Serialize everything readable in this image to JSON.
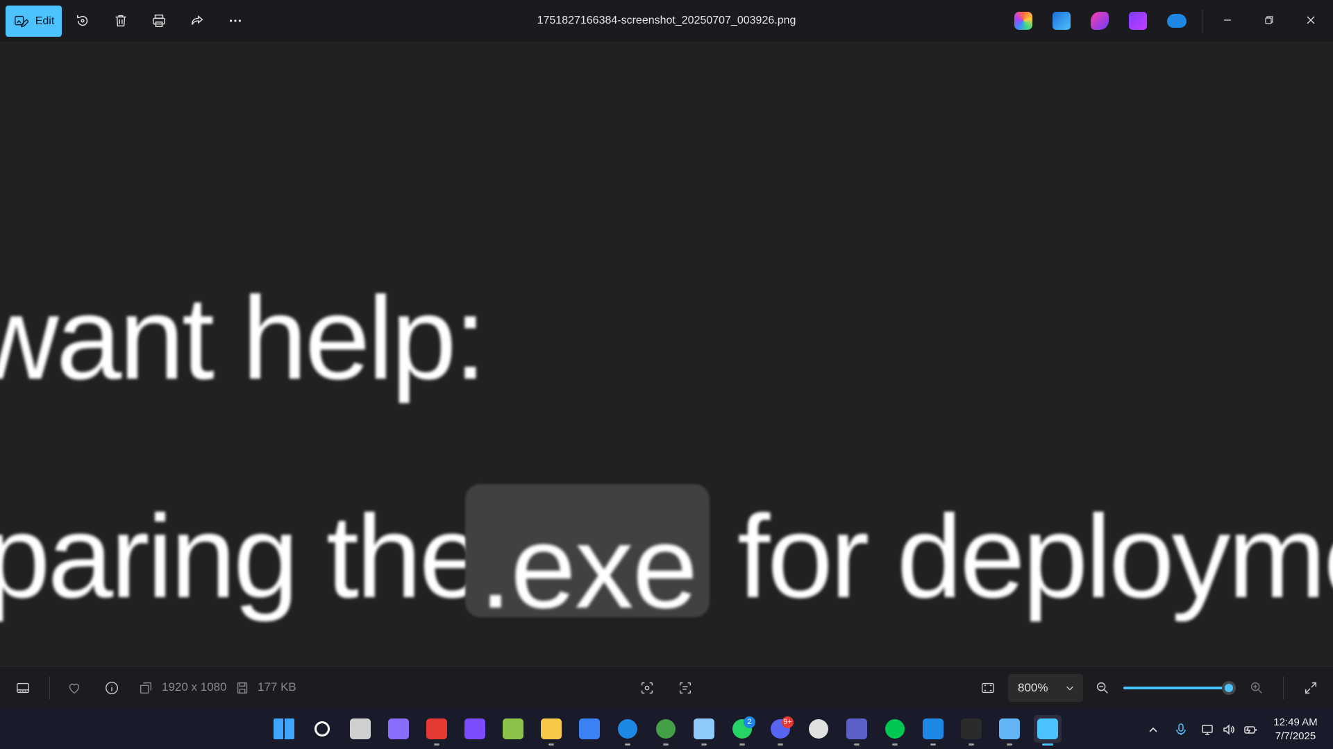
{
  "toolbar": {
    "edit_label": "Edit",
    "file_title": "1751827166384-screenshot_20250707_003926.png",
    "accent": "#4cc2ff"
  },
  "toolbar_icons": [
    "rotate-icon",
    "delete-icon",
    "print-icon",
    "share-icon",
    "more-icon"
  ],
  "toolbar_apps": [
    "copilot-icon",
    "photos-icon",
    "clipchamp-icon",
    "designer-icon",
    "onedrive-icon"
  ],
  "canvas": {
    "line1": "want help:",
    "line2_before": "paring the",
    "code": ".exe",
    "line2_after": "for deploymer"
  },
  "info_bar": {
    "dimensions": "1920 x 1080",
    "file_size": "177 KB",
    "zoom_value": "800%",
    "zoom_slider_fraction": 0.93
  },
  "taskbar": {
    "apps": [
      {
        "name": "start",
        "color": "#3ea6ff"
      },
      {
        "name": "search",
        "color": "#ffffff"
      },
      {
        "name": "task-view",
        "color": "#cfcfcf"
      },
      {
        "name": "copilot",
        "color": "#8a6cff"
      },
      {
        "name": "snipping-tool",
        "color": "#e53935"
      },
      {
        "name": "visual-studio",
        "color": "#7c4dff"
      },
      {
        "name": "app-chameleon",
        "color": "#8bc34a"
      },
      {
        "name": "file-explorer",
        "color": "#f7c948"
      },
      {
        "name": "microsoft-store",
        "color": "#3b82f6"
      },
      {
        "name": "edge",
        "color": "#1e88e5"
      },
      {
        "name": "chrome",
        "color": "#43a047"
      },
      {
        "name": "remote-desktop",
        "color": "#90caf9"
      },
      {
        "name": "whatsapp",
        "color": "#25d366",
        "badge": "2"
      },
      {
        "name": "discord",
        "color": "#5865f2",
        "badge": "9+"
      },
      {
        "name": "chatgpt",
        "color": "#e0e0e0"
      },
      {
        "name": "teams",
        "color": "#5b5fc7"
      },
      {
        "name": "mongodb-compass",
        "color": "#00c853"
      },
      {
        "name": "vs-code",
        "color": "#1e88e5"
      },
      {
        "name": "terminal",
        "color": "#2b2b2b"
      },
      {
        "name": "photos-mountain",
        "color": "#64b5f6"
      },
      {
        "name": "photos",
        "color": "#4cc2ff",
        "active": true
      }
    ],
    "clock_time": "12:49 AM",
    "clock_date": "7/7/2025"
  }
}
